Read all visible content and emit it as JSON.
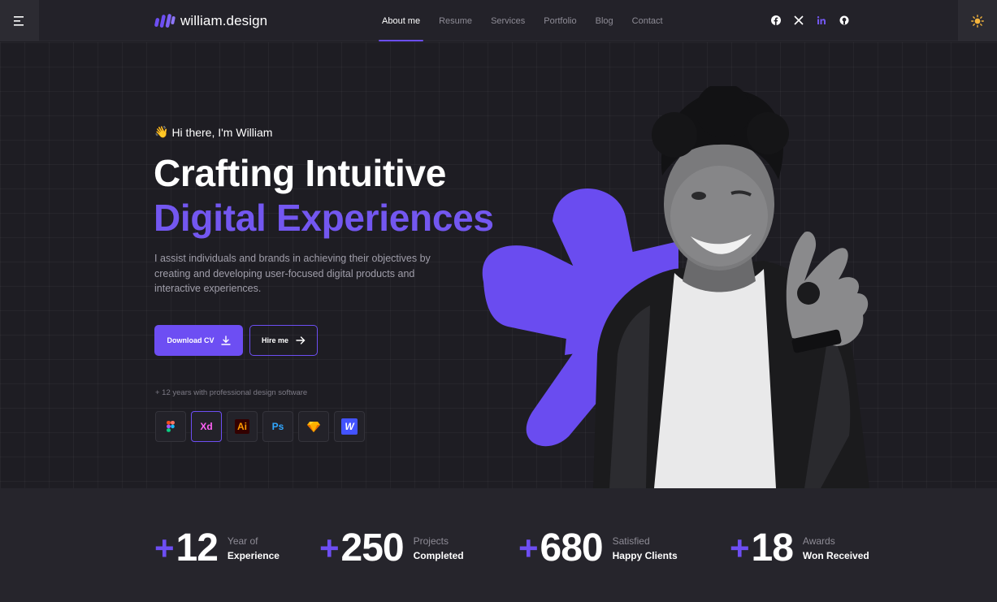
{
  "header": {
    "logo_text": "william.design",
    "nav": [
      {
        "label": "About me",
        "active": true
      },
      {
        "label": "Resume",
        "active": false
      },
      {
        "label": "Services",
        "active": false
      },
      {
        "label": "Portfolio",
        "active": false
      },
      {
        "label": "Blog",
        "active": false
      },
      {
        "label": "Contact",
        "active": false
      }
    ],
    "socials": [
      "facebook-icon",
      "x-icon",
      "linkedin-icon",
      "github-icon"
    ],
    "menu_icon": "hamburger-icon",
    "theme_icon": "sun-icon"
  },
  "hero": {
    "greeting_emoji": "👋",
    "greeting": "Hi there, I'm William",
    "headline_line1": "Crafting Intuitive",
    "headline_line2": "Digital Experiences",
    "intro": "I assist individuals and brands in achieving their objectives by creating and developing user-focused digital products and interactive experiences.",
    "download_label": "Download CV",
    "hire_label": "Hire me",
    "software_note": "+ 12 years with professional design software",
    "tools": [
      {
        "name": "figma-icon",
        "glyph": "",
        "active": false
      },
      {
        "name": "adobe-xd-icon",
        "glyph": "Xd",
        "active": true
      },
      {
        "name": "adobe-illustrator-icon",
        "glyph": "Ai",
        "active": false
      },
      {
        "name": "adobe-photoshop-icon",
        "glyph": "Ps",
        "active": false
      },
      {
        "name": "sketch-icon",
        "glyph": "",
        "active": false
      },
      {
        "name": "webflow-icon",
        "glyph": "W",
        "active": false
      }
    ]
  },
  "stats": [
    {
      "plus": "+",
      "number": "12",
      "line1": "Year of",
      "line2": "Experience"
    },
    {
      "plus": "+",
      "number": "250",
      "line1": "Projects",
      "line2": "Completed"
    },
    {
      "plus": "+",
      "number": "680",
      "line1": "Satisfied",
      "line2": "Happy Clients"
    },
    {
      "plus": "+",
      "number": "18",
      "line1": "Awards",
      "line2": "Won Received"
    }
  ],
  "colors": {
    "accent": "#6d4ef3",
    "background": "#1e1d23",
    "stats_background": "#26252c"
  }
}
